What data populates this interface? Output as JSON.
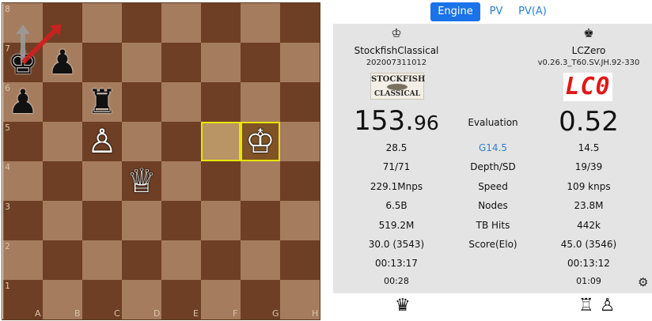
{
  "board": {
    "rank_labels": [
      "8",
      "7",
      "6",
      "5",
      "4",
      "3",
      "2",
      "1"
    ],
    "file_labels": [
      "A",
      "B",
      "C",
      "D",
      "E",
      "F",
      "G",
      "H"
    ],
    "pieces": [
      {
        "square": "a7",
        "color": "black",
        "glyph": "♚",
        "name": "black-king-icon"
      },
      {
        "square": "b7",
        "color": "black",
        "glyph": "♟",
        "name": "black-pawn-icon"
      },
      {
        "square": "a6",
        "color": "black",
        "glyph": "♟",
        "name": "black-pawn-icon"
      },
      {
        "square": "c6",
        "color": "black",
        "glyph": "♜",
        "name": "black-rook-icon"
      },
      {
        "square": "c5",
        "color": "white",
        "glyph": "♙",
        "name": "white-pawn-icon"
      },
      {
        "square": "g5",
        "color": "white",
        "glyph": "♔",
        "name": "white-king-icon"
      },
      {
        "square": "d4",
        "color": "white",
        "glyph": "♕",
        "name": "white-queen-icon"
      }
    ],
    "highlights": [
      "f5",
      "g5"
    ],
    "arrows": [
      {
        "from": "a7",
        "to": "a8",
        "color": "#9a9a9a",
        "name": "gray-arrow-icon"
      },
      {
        "from": "a7",
        "to": "b8",
        "color": "#d02020",
        "name": "red-arrow-icon"
      }
    ]
  },
  "tabs": [
    {
      "label": "Engine",
      "active": true
    },
    {
      "label": "PV",
      "active": false
    },
    {
      "label": "PV(A)",
      "active": false
    }
  ],
  "left_engine": {
    "side_icon": "♔",
    "name": "StockfishClassical",
    "version": "20200731101 2",
    "logo_text_top": "STOCKFISH",
    "logo_text_bottom": "CLASSICAL",
    "eval_int": "153.",
    "eval_frac": "96"
  },
  "right_engine": {
    "side_icon": "♚",
    "name": "LCZero",
    "version": "v0.26.3_T60.SV.JH.92-330",
    "logo_text": "LC0",
    "eval": "0.52"
  },
  "center": {
    "eval_label": "Evaluation"
  },
  "rows": [
    {
      "left": "28.5",
      "label": "G14.5",
      "right": "14.5",
      "blue": true
    },
    {
      "left": "71/71",
      "label": "Depth/SD",
      "right": "19/39",
      "blue": false
    },
    {
      "left": "229.1Mnps",
      "label": "Speed",
      "right": "109 knps",
      "blue": false
    },
    {
      "left": "6.5B",
      "label": "Nodes",
      "right": "23.8M",
      "blue": false
    },
    {
      "left": "519.2M",
      "label": "TB Hits",
      "right": "442k",
      "blue": false
    },
    {
      "left": "30.0 (3543)",
      "label": "Score(Elo)",
      "right": "45.0 (3546)",
      "blue": false
    },
    {
      "left": "00:13:17",
      "label": "",
      "right": "00:13:12",
      "blue": false
    }
  ],
  "times": {
    "left": "00:28",
    "right": "01:09"
  },
  "bottom": {
    "left_piece": "♛",
    "right_pieces": "♖ ♙"
  }
}
